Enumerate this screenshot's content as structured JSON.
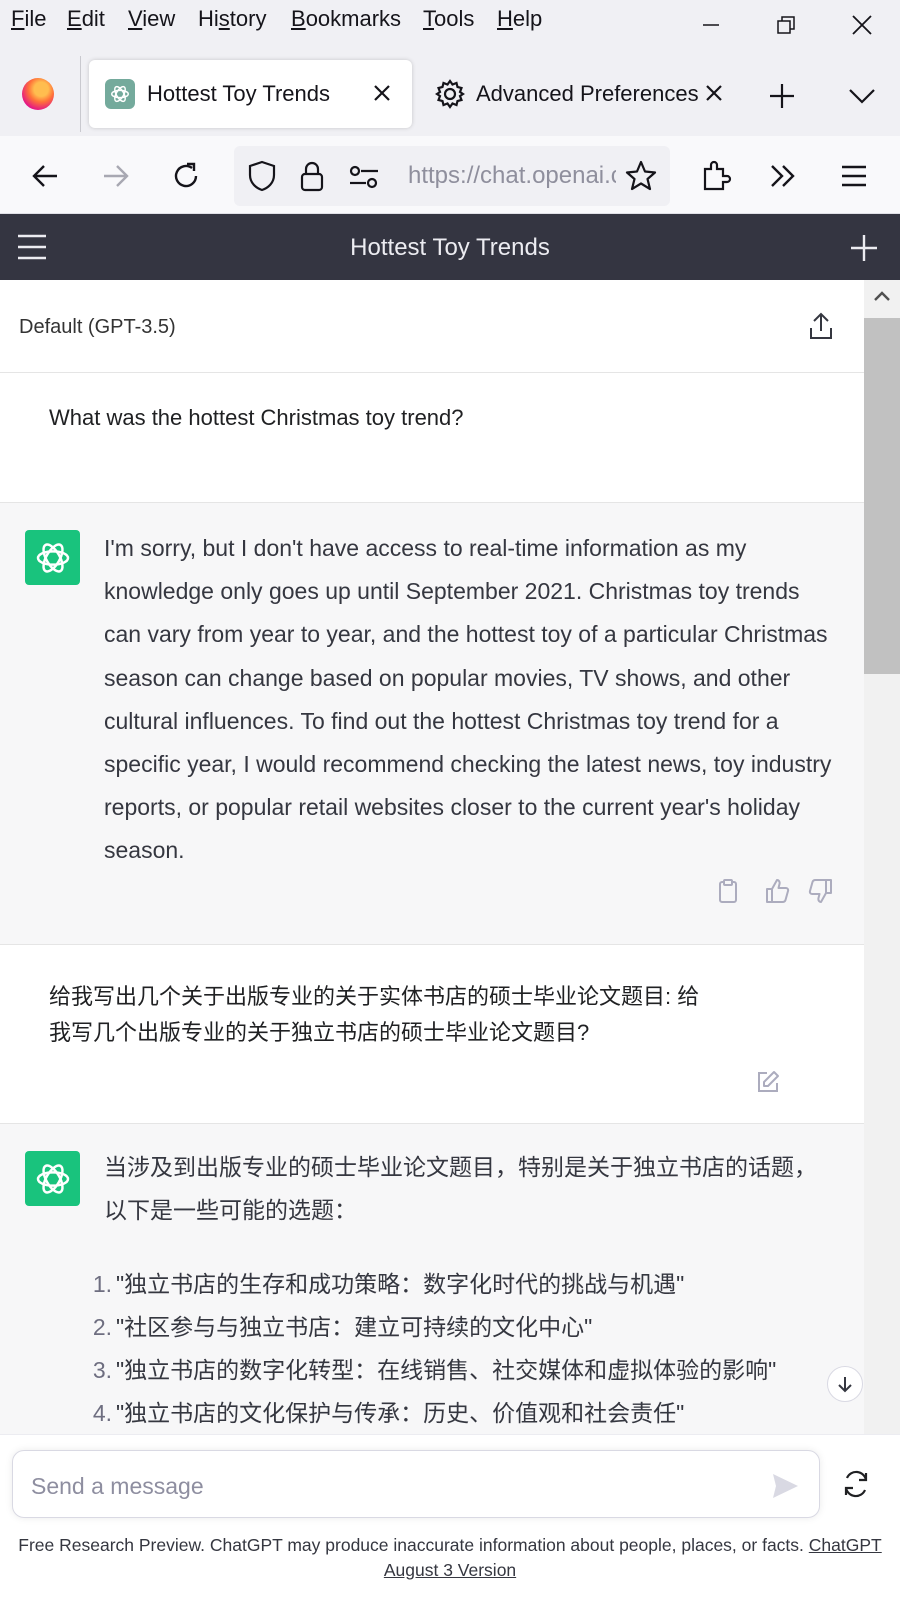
{
  "menu": {
    "items": [
      {
        "before": "",
        "key": "F",
        "after": "ile"
      },
      {
        "before": "",
        "key": "E",
        "after": "dit"
      },
      {
        "before": "",
        "key": "V",
        "after": "iew"
      },
      {
        "before": "Hi",
        "key": "s",
        "after": "tory"
      },
      {
        "before": "",
        "key": "B",
        "after": "ookmarks"
      },
      {
        "before": "",
        "key": "T",
        "after": "ools"
      },
      {
        "before": "",
        "key": "H",
        "after": "elp"
      }
    ]
  },
  "tabs": {
    "active_title": "Hottest Toy Trends",
    "second_title": "Advanced Preferences"
  },
  "navbar": {
    "url": "https://chat.openai.com"
  },
  "chat": {
    "header_title": "Hottest Toy Trends",
    "model_label": "Default (GPT-3.5)",
    "user_message_1": "What was the hottest Christmas toy trend?",
    "assistant_message_1": "I'm sorry, but I don't have access to real-time information as my knowledge only goes up until September 2021. Christmas toy trends can vary from year to year, and the hottest toy of a particular Christmas season can change based on popular movies, TV shows, and other cultural influences. To find out the hottest Christmas toy trend for a specific year, I would recommend checking the latest news, toy industry reports, or popular retail websites closer to the current year's holiday season.",
    "user_message_2_line1": "给我写出几个关于出版专业的关于实体书店的硕士毕业论文题目: 给",
    "user_message_2_line2": "我写几个出版专业的关于独立书店的硕士毕业论文题目?",
    "assistant_message_2_intro": "当涉及到出版专业的硕士毕业论文题目，特别是关于独立书店的话题，以下是一些可能的选题：",
    "assistant_message_2_list": [
      {
        "num": "1.",
        "text": "\"独立书店的生存和成功策略：数字化时代的挑战与机遇\""
      },
      {
        "num": "2.",
        "text": "\"社区参与与独立书店：建立可持续的文化中心\""
      },
      {
        "num": "3.",
        "text": "\"独立书店的数字化转型：在线销售、社交媒体和虚拟体验的影响\""
      },
      {
        "num": "4.",
        "text": "\"独立书店的文化保护与传承：历史、价值观和社会责任\""
      }
    ]
  },
  "composer": {
    "placeholder": "Send a message",
    "footer_text": "Free Research Preview. ChatGPT may produce inaccurate information about people, places, or facts.",
    "footer_link": "ChatGPT August 3 Version"
  },
  "colors": {
    "header_bg": "#343541",
    "assistant_avatar": "#19c37d",
    "assistant_bg": "#f7f7f8"
  },
  "icons": [
    "firefox-logo-icon",
    "openai-favicon-icon",
    "gear-icon",
    "close-icon",
    "plus-icon",
    "chevron-down-icon",
    "back-arrow-icon",
    "forward-arrow-icon",
    "reload-icon",
    "shield-icon",
    "lock-icon",
    "permissions-icon",
    "star-icon",
    "extensions-icon",
    "overflow-chevrons-icon",
    "hamburger-icon",
    "share-icon",
    "clipboard-icon",
    "thumbs-up-icon",
    "thumbs-down-icon",
    "edit-icon",
    "arrow-down-icon",
    "send-icon",
    "regenerate-icon"
  ]
}
